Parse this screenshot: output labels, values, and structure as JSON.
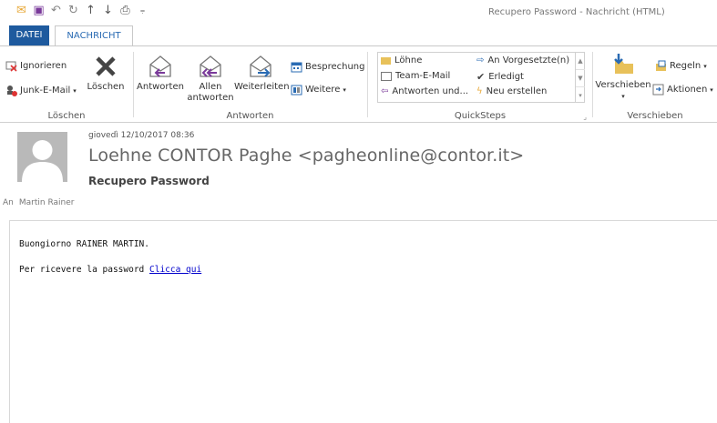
{
  "window": {
    "title": "Recupero Password - Nachricht (HTML)"
  },
  "qat": {
    "icons": [
      "mail-icon",
      "save-icon",
      "undo-icon",
      "redo-icon",
      "up-icon",
      "down-icon",
      "print-icon",
      "customize-icon"
    ]
  },
  "tabs": {
    "datei": "DATEI",
    "nachricht": "NACHRICHT"
  },
  "ribbon": {
    "loeschen": {
      "label": "Löschen",
      "ignorieren": "Ignorieren",
      "junk": "Junk-E-Mail",
      "loeschen_btn": "Löschen"
    },
    "antworten": {
      "label": "Antworten",
      "antworten_btn": "Antworten",
      "allen1": "Allen",
      "allen2": "antworten",
      "weiterleiten": "Weiterleiten",
      "besprechung": "Besprechung",
      "weitere": "Weitere"
    },
    "quicksteps": {
      "label": "QuickSteps",
      "items": [
        "Löhne",
        "Team-E-Mail",
        "Antworten und...",
        "An Vorgesetzte(n)",
        "Erledigt",
        "Neu erstellen"
      ]
    },
    "verschieben": {
      "label": "Verschieben",
      "verschieben_btn": "Verschieben",
      "regeln": "Regeln",
      "aktionen": "Aktionen"
    }
  },
  "message": {
    "date": "giovedì 12/10/2017 08:36",
    "sender": "Loehne CONTOR Paghe <pagheonline@contor.it>",
    "subject": "Recupero Password",
    "to_label": "An",
    "to_name": "Martin Rainer",
    "body_line1": "Buongiorno RAINER MARTIN.",
    "body_line2": "Per ricevere la password",
    "link_text": "Clicca qui"
  }
}
